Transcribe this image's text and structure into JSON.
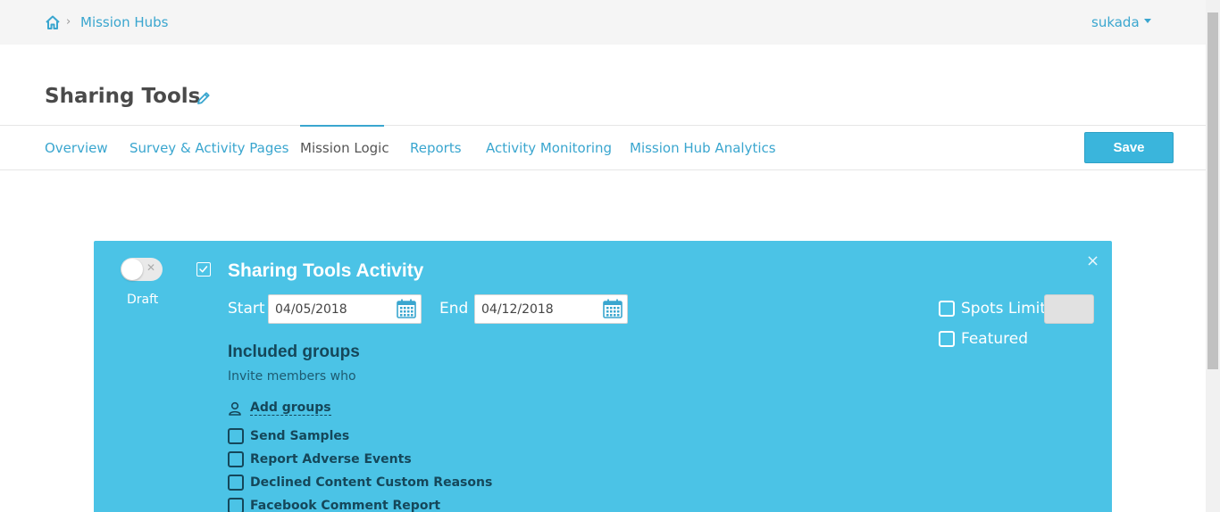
{
  "breadcrumb": {
    "link": "Mission Hubs"
  },
  "user": {
    "name": "sukada"
  },
  "page": {
    "title": "Sharing Tools"
  },
  "tabs": [
    {
      "label": "Overview"
    },
    {
      "label": "Survey & Activity Pages"
    },
    {
      "label": "Mission Logic"
    },
    {
      "label": "Reports"
    },
    {
      "label": "Activity Monitoring"
    },
    {
      "label": "Mission Hub Analytics"
    }
  ],
  "active_tab": "Mission Logic",
  "actions": {
    "save_label": "Save"
  },
  "activity": {
    "status_label": "Draft",
    "title": "Sharing Tools Activity",
    "start_label": "Start",
    "start_date": "04/05/2018",
    "end_label": "End",
    "end_date": "04/12/2018",
    "spots_limit_label": "Spots Limit",
    "featured_label": "Featured",
    "included_groups_heading": "Included groups",
    "invite_text": "Invite members who",
    "add_groups_label": "Add groups",
    "groups": [
      {
        "label": "Send Samples"
      },
      {
        "label": "Report Adverse Events"
      },
      {
        "label": "Declined Content Custom Reasons"
      },
      {
        "label": "Facebook Comment Report"
      }
    ]
  },
  "colors": {
    "accent": "#3aa6cf",
    "card": "#4bc3e6",
    "dark_text": "#15475a"
  }
}
